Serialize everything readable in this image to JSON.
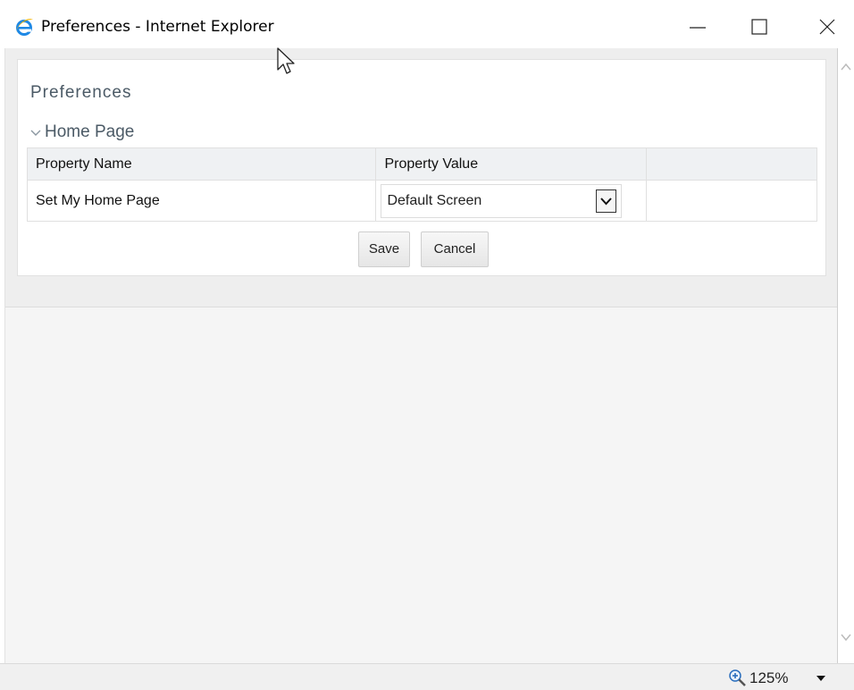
{
  "window": {
    "title": "Preferences - Internet Explorer",
    "icon": "internet-explorer-icon",
    "controls": [
      "minimize-icon",
      "maximize-icon",
      "close-icon"
    ]
  },
  "panel": {
    "title": "Preferences",
    "section": {
      "label": "Home Page",
      "expanded": true
    },
    "table": {
      "headers": [
        "Property Name",
        "Property Value",
        ""
      ],
      "rows": [
        {
          "name": "Set My Home Page",
          "value": "Default Screen"
        }
      ]
    },
    "buttons": {
      "save_label": "Save",
      "cancel_label": "Cancel"
    }
  },
  "statusbar": {
    "zoom": "125%"
  },
  "colors": {
    "title_text": "#4b5a66",
    "panel_bg": "#ffffff",
    "page_bg": "#f5f5f5",
    "header_bg": "#eff1f3",
    "ie_blue": "#1e88e5",
    "ie_gold": "#f5b400"
  }
}
